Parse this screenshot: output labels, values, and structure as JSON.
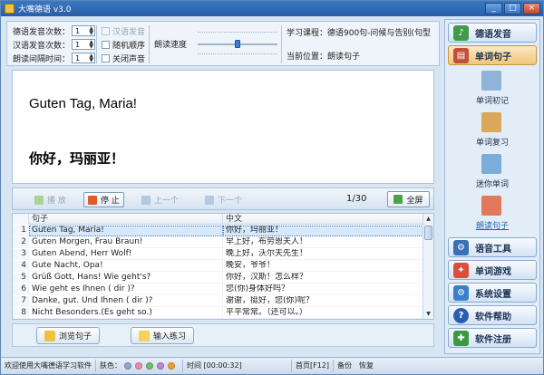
{
  "window": {
    "title": "大嘴德语 v3.0",
    "minimize": "_",
    "maximize": "□",
    "close": "×"
  },
  "settings": {
    "de_count_label": "德语发音次数：",
    "de_count_value": "1",
    "zh_count_label": "汉语发音次数：",
    "zh_count_value": "1",
    "interval_label": "朗读间隔时间：",
    "interval_value": "1",
    "chk_zh_voice": "汉语发音",
    "chk_random": "随机顺序",
    "chk_mute": "关闭声音",
    "speed_label": "朗读速度",
    "speed_level": 0.5,
    "course_label": "学习课程：德语900句-问候与告别(句型",
    "position_label": "当前位置：朗读句子"
  },
  "nav": {
    "de_voice": "德语发音",
    "sentences": "单词句子",
    "sub": [
      "单词初记",
      "单词复习",
      "迷你单词",
      "朗读句子"
    ],
    "tools": "语音工具",
    "games": "单词游戏",
    "system": "系统设置",
    "help": "软件帮助",
    "register": "软件注册"
  },
  "display": {
    "german": "Guten Tag, Maria!",
    "chinese": "你好，玛丽亚！"
  },
  "controls": {
    "play": "播 放",
    "stop": "停 止",
    "prev": "上一个",
    "next": "下一个",
    "counter": "1/30",
    "fullscreen": "全屏"
  },
  "table": {
    "headers": [
      "",
      "句子",
      "中文"
    ],
    "rows": [
      {
        "n": "1",
        "de": "Guten Tag, Maria!",
        "zh": "你好，玛丽亚！"
      },
      {
        "n": "2",
        "de": "Guten Morgen, Frau Braun!",
        "zh": "早上好，布劳恩夫人！"
      },
      {
        "n": "3",
        "de": "Guten Abend, Herr Wolf!",
        "zh": "晚上好，沃尔夫先生！"
      },
      {
        "n": "4",
        "de": "Gute Nacht, Opa!",
        "zh": "晚安，爷爷！"
      },
      {
        "n": "5",
        "de": "Grüß Gott, Hans! Wie geht's?",
        "zh": "你好，汉斯！怎么样？"
      },
      {
        "n": "6",
        "de": "Wie geht es Ihnen ( dir )?",
        "zh": "您(你)身体好吗？"
      },
      {
        "n": "7",
        "de": "Danke, gut. Und Ihnen ( dir )?",
        "zh": "谢谢，挺好，您(你)呢？"
      },
      {
        "n": "8",
        "de": "Nicht Besonders.(Es geht so.)",
        "zh": "平平常常。（还可以。）"
      }
    ]
  },
  "bottom": {
    "browse": "浏览句子",
    "practice": "输入练习"
  },
  "status": {
    "welcome": "欢迎使用大嘴德语学习软件",
    "skin_label": "肤色：",
    "skin_colors": [
      "#8fa8c8",
      "#f08aa8",
      "#6fbf6f",
      "#b58ad8",
      "#f0a030"
    ],
    "time": "时间 [00:00:32]",
    "first_page": "首页[F12]",
    "backup": "备份",
    "restore": "恢复"
  }
}
